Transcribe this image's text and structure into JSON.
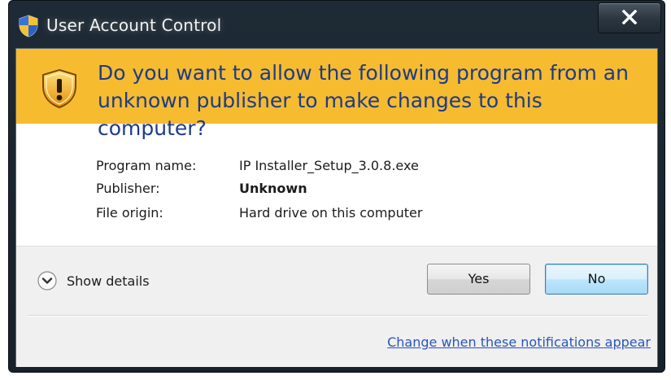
{
  "window": {
    "title": "User Account Control",
    "close_label": "×",
    "icons": {
      "title": "uac-shield-icon",
      "close": "close-icon"
    }
  },
  "banner": {
    "question": "Do you want to allow the following program from an unknown publisher to make changes to this computer?",
    "icon": "warning-shield-icon",
    "color": "#f6bb2f",
    "text_color": "#1d3b88"
  },
  "info": {
    "program_name": {
      "label": "Program name:",
      "value": "IP Installer_Setup_3.0.8.exe"
    },
    "publisher": {
      "label": "Publisher:",
      "value": "Unknown"
    },
    "file_origin": {
      "label": "File origin:",
      "value": "Hard drive on this computer"
    }
  },
  "footer": {
    "show_details": "Show details",
    "show_details_icon": "chevron-down-circle-icon",
    "yes": "Yes",
    "no": "No",
    "notifications_link": "Change when these notifications appear",
    "link_color": "#2a55b8"
  }
}
